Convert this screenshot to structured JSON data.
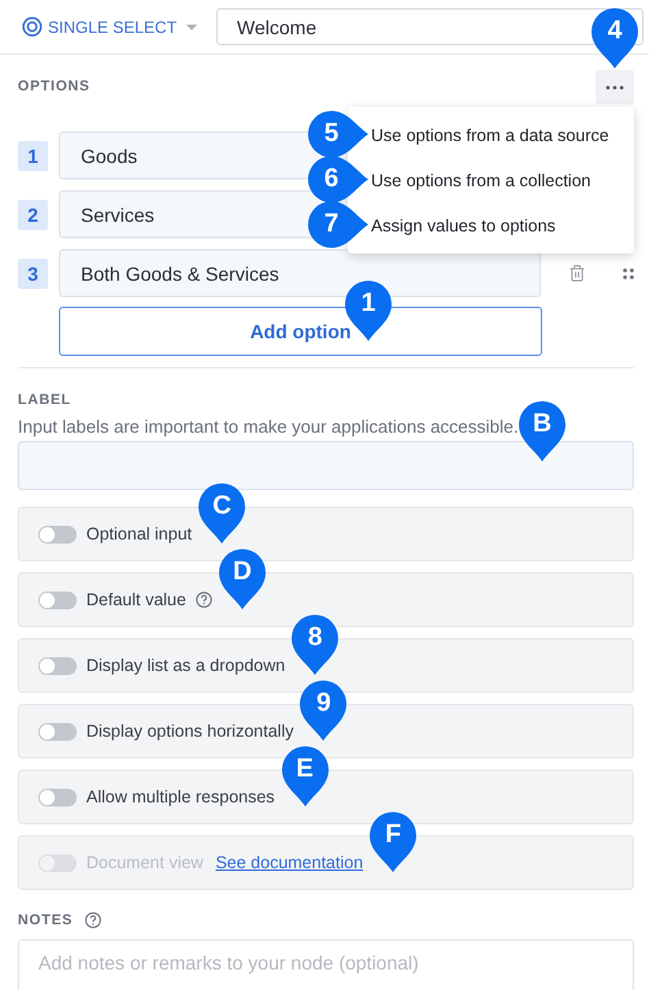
{
  "top_bar": {
    "type_label": "SINGLE SELECT",
    "title_value": "Welcome"
  },
  "options_section": {
    "heading": "OPTIONS",
    "more_marker": "4",
    "menu": {
      "open": true,
      "items": [
        {
          "label": "Use options from a data source",
          "marker": "5"
        },
        {
          "label": "Use options from a collection",
          "marker": "6"
        },
        {
          "label": "Assign values to options",
          "marker": "7"
        }
      ]
    },
    "options": [
      {
        "number": "1",
        "value": "Goods"
      },
      {
        "number": "2",
        "value": "Services"
      },
      {
        "number": "3",
        "value": "Both Goods & Services"
      }
    ],
    "add_button": {
      "label": "Add option",
      "marker": "1"
    }
  },
  "label_section": {
    "heading": "LABEL",
    "help": "Input labels are important to make your applications accessible.",
    "marker": "B"
  },
  "toggles": [
    {
      "label": "Optional input",
      "on": false,
      "disabled": false,
      "marker": "C"
    },
    {
      "label": "Default value",
      "on": false,
      "disabled": false,
      "help_icon": true,
      "marker": "D"
    },
    {
      "label": "Display list as a dropdown",
      "on": false,
      "disabled": false,
      "marker": "8"
    },
    {
      "label": "Display options horizontally",
      "on": false,
      "disabled": false,
      "marker": "9"
    },
    {
      "label": "Allow multiple responses",
      "on": false,
      "disabled": false,
      "marker": "E"
    },
    {
      "label": "Document view",
      "on": false,
      "disabled": true,
      "link": "See documentation",
      "marker": "F"
    }
  ],
  "notes": {
    "heading": "NOTES",
    "placeholder": "Add notes or remarks to your node (optional)"
  }
}
